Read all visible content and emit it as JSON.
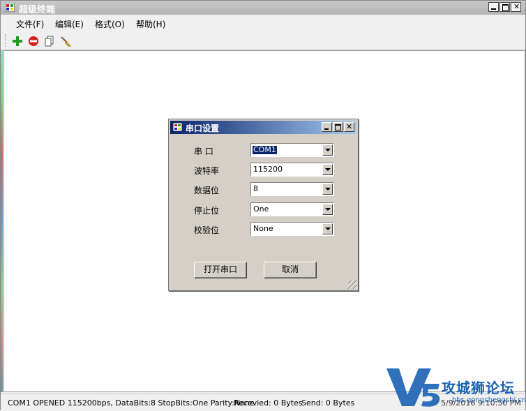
{
  "window": {
    "title": "超级终端"
  },
  "menu": {
    "items": [
      "文件(F)",
      "编辑(E)",
      "格式(O)",
      "帮助(H)"
    ]
  },
  "toolbar": {
    "icons": [
      "add-icon",
      "remove-icon",
      "copy-icon",
      "clear-icon"
    ]
  },
  "dialog": {
    "title": "串口设置",
    "fields": [
      {
        "label": "串  口",
        "value": "COM1"
      },
      {
        "label": "波特率",
        "value": "115200"
      },
      {
        "label": "数据位",
        "value": "8"
      },
      {
        "label": "停止位",
        "value": "One"
      },
      {
        "label": "校验位",
        "value": "None"
      }
    ],
    "open_button": "打开串口",
    "cancel_button": "取消"
  },
  "status": {
    "connection": "COM1 OPENED 115200bps, DataBits:8 StopBits:One Parity:None",
    "received": "Recevied: 0 Bytes",
    "send": "Send: 0 Bytes",
    "datetime": "5/9/2016 9:10:50 PM"
  },
  "watermark": {
    "text": "攻城狮论坛",
    "url": "bbs.gongchengshi.cn"
  },
  "colors": {
    "dialog_title": "#0a246a",
    "brand": "#1a62b5"
  }
}
